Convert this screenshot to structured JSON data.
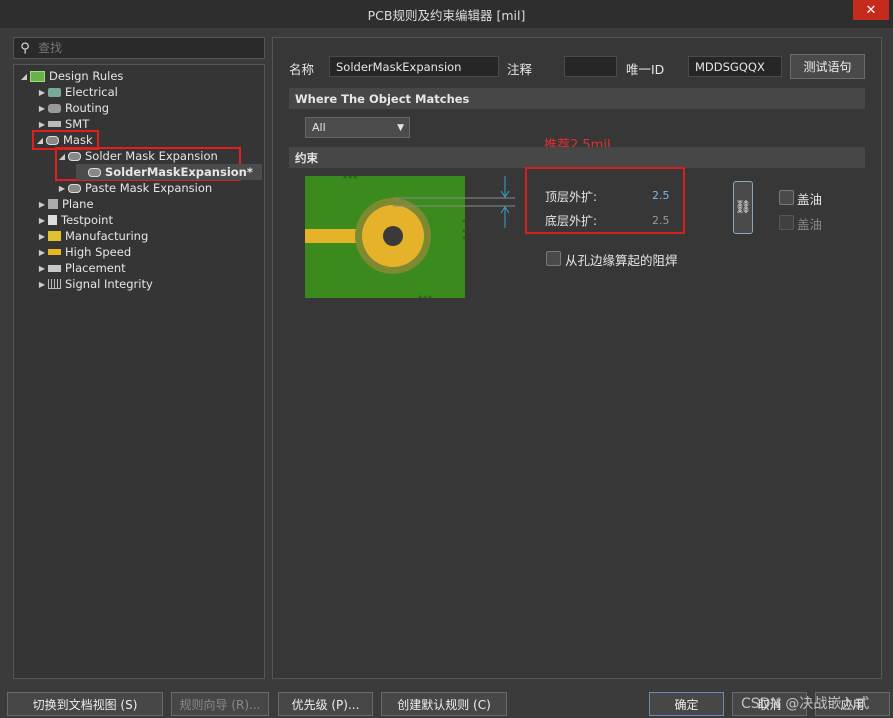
{
  "window": {
    "title": "PCB规则及约束编辑器 [mil]",
    "close": "✕"
  },
  "search": {
    "placeholder": "查找"
  },
  "tree": {
    "root": "Design Rules",
    "items": {
      "electrical": "Electrical",
      "routing": "Routing",
      "smt": "SMT",
      "mask": "Mask",
      "solder_mask_expansion": "Solder Mask Expansion",
      "solder_rule": "SolderMaskExpansion*",
      "paste_mask_expansion": "Paste Mask Expansion",
      "plane": "Plane",
      "testpoint": "Testpoint",
      "manufacturing": "Manufacturing",
      "high_speed": "High Speed",
      "placement": "Placement",
      "signal_integrity": "Signal Integrity"
    }
  },
  "rule": {
    "name_label": "名称",
    "name_value": "SolderMaskExpansion",
    "comment_label": "注释",
    "comment_value": "",
    "id_label": "唯一ID",
    "id_value": "MDDSGQQX",
    "test_button": "测试语句"
  },
  "where": {
    "header": "Where The Object Matches",
    "selected": "All"
  },
  "constraints": {
    "header": "约束",
    "top_label": "顶层外扩:",
    "top_value": "2.5",
    "bottom_label": "底层外扩:",
    "bottom_value": "2.5",
    "tent_top": "盖油",
    "tent_bottom": "盖油",
    "from_hole_edge": "从孔边缘算起的阻焊",
    "recommend_note": "推荐2.5mil"
  },
  "bottom_bar": {
    "switch_view": "切换到文档视图 (S)",
    "rule_wizard": "规则向导 (R)...",
    "priority": "优先级 (P)...",
    "create_default": "创建默认规则 (C)",
    "ok": "确定",
    "cancel": "取消",
    "apply": "应用"
  },
  "watermark": "CSDN @决战嵌入式",
  "colors": {
    "highlight": "#d42020",
    "board_green": "#3a8a1e",
    "pad_yellow": "#e6b22a"
  }
}
